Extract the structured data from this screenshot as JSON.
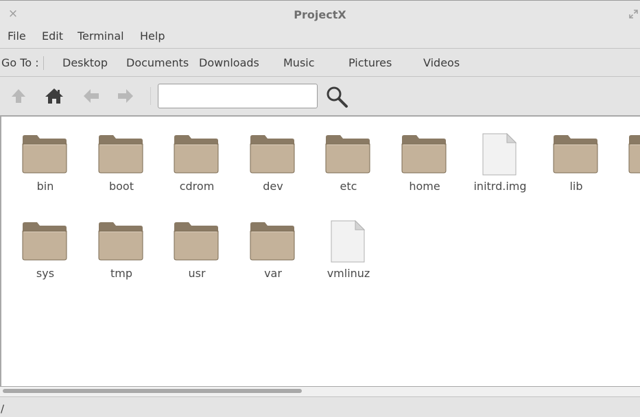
{
  "window": {
    "title": "ProjectX",
    "close_icon": "×",
    "maximize_icon": "maximize-icon"
  },
  "menu": {
    "items": [
      {
        "label": "File"
      },
      {
        "label": "Edit"
      },
      {
        "label": "Terminal"
      },
      {
        "label": "Help"
      }
    ]
  },
  "goto": {
    "label": "Go To :",
    "buttons": [
      {
        "label": "Desktop"
      },
      {
        "label": "Documents"
      },
      {
        "label": "Downloads"
      },
      {
        "label": "Music"
      },
      {
        "label": "Pictures"
      },
      {
        "label": "Videos"
      }
    ]
  },
  "toolbar": {
    "icons": [
      "up-arrow-icon",
      "home-icon",
      "back-arrow-icon",
      "forward-arrow-icon",
      "search-icon"
    ],
    "location_value": "",
    "location_placeholder": ""
  },
  "files": {
    "row1": [
      {
        "name": "bin",
        "type": "folder"
      },
      {
        "name": "boot",
        "type": "folder"
      },
      {
        "name": "cdrom",
        "type": "folder"
      },
      {
        "name": "dev",
        "type": "folder"
      },
      {
        "name": "etc",
        "type": "folder"
      },
      {
        "name": "home",
        "type": "folder"
      },
      {
        "name": "initrd.img",
        "type": "file"
      },
      {
        "name": "lib",
        "type": "folder"
      },
      {
        "name": "",
        "type": "folder"
      }
    ],
    "row2": [
      {
        "name": "sys",
        "type": "folder"
      },
      {
        "name": "tmp",
        "type": "folder"
      },
      {
        "name": "usr",
        "type": "folder"
      },
      {
        "name": "var",
        "type": "folder"
      },
      {
        "name": "vmlinuz",
        "type": "file"
      }
    ]
  },
  "status": {
    "path": "/"
  },
  "colors": {
    "folder_body": "#c4b29a",
    "folder_back": "#8a7a64",
    "folder_edge": "#7a6a52",
    "file_page": "#f2f2f2",
    "icon_gray": "#b9b9b9",
    "icon_dark": "#3d3d3d"
  }
}
